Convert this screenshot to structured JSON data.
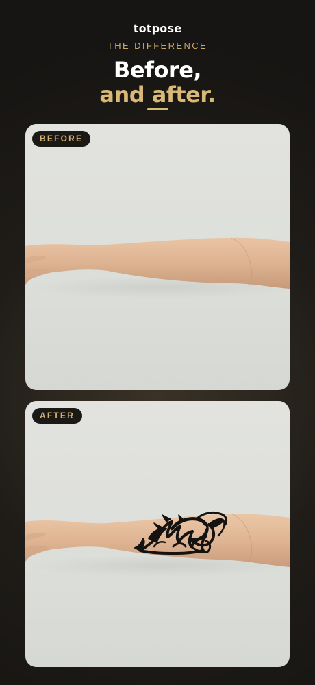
{
  "brand": "totpose",
  "eyebrow": "THE DIFFERENCE",
  "headline": {
    "line1": "Before,",
    "line2": "and after."
  },
  "cards": [
    {
      "badge": "BEFORE",
      "image": "bare-forearm-photo"
    },
    {
      "badge": "AFTER",
      "image": "forearm-with-dragon-tattoo-photo"
    }
  ],
  "colors": {
    "background": "#1f1c18",
    "accent_gold": "#d9b978",
    "badge_bg": "#1b1916"
  }
}
